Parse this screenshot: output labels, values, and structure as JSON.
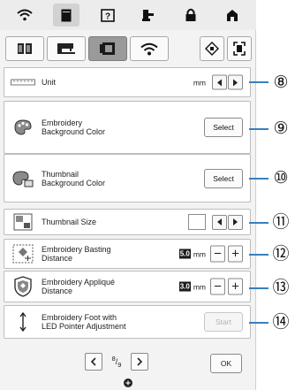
{
  "top_icons": [
    {
      "name": "wifi-status-icon",
      "active": false
    },
    {
      "name": "page-icon",
      "active": true
    },
    {
      "name": "help-icon",
      "active": false
    },
    {
      "name": "presser-foot-icon",
      "active": false
    },
    {
      "name": "lock-icon",
      "active": false
    },
    {
      "name": "home-icon",
      "active": false
    }
  ],
  "tabs": [
    {
      "name": "book-icon",
      "active": false
    },
    {
      "name": "sewing-machine-icon",
      "active": false
    },
    {
      "name": "embroidery-frame-icon",
      "active": true
    },
    {
      "name": "wifi-icon",
      "active": false
    },
    {
      "name": "settings-diamond-icon",
      "active": false
    },
    {
      "name": "frame-bracket-icon",
      "active": false
    }
  ],
  "settings": {
    "unit": {
      "label": "Unit",
      "value": "mm"
    },
    "embroidery_bg": {
      "label_line1": "Embroidery",
      "label_line2": "Background Color",
      "button": "Select"
    },
    "thumbnail_bg": {
      "label_line1": "Thumbnail",
      "label_line2": "Background Color",
      "button": "Select"
    },
    "thumbnail_size": {
      "label": "Thumbnail Size"
    },
    "basting": {
      "label_line1": "Embroidery Basting",
      "label_line2": "Distance",
      "value": "5.0",
      "unit": "mm"
    },
    "applique": {
      "label_line1": "Embroidery Appliqué",
      "label_line2": "Distance",
      "value": "3.0",
      "unit": "mm"
    },
    "foot_led": {
      "label_line1": "Embroidery Foot with",
      "label_line2": "LED Pointer Adjustment",
      "button": "Start",
      "enabled": false
    }
  },
  "pagination": {
    "current": "8",
    "total": "9"
  },
  "ok_label": "OK",
  "callouts": [
    "⑧",
    "⑨",
    "⑩",
    "⑪",
    "⑫",
    "⑬",
    "⑭"
  ],
  "colors": {
    "callout_line": "#3a7fc0",
    "active_tab": "#9a9a9a",
    "panel": "#f3f3f3"
  }
}
